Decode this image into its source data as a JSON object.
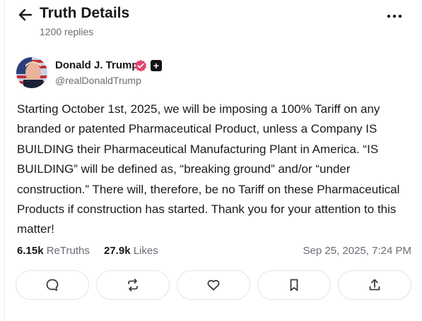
{
  "header": {
    "title": "Truth Details",
    "replies": "1200 replies"
  },
  "post": {
    "author_name": "Donald J. Trump",
    "handle": "@realDonaldTrump",
    "plus_badge": "+",
    "text": "Starting October 1st, 2025, we will be imposing a 100% Tariff on any branded or patented Pharmaceutical Product, unless a Company IS BUILDING their Pharmaceutical Manufacturing Plant in America. “IS BUILDING” will be defined as, “breaking ground” and/or “under construction.” There will, therefore, be no Tariff on these Pharmaceutical Products if construction has started. Thank you for your attention to this matter!",
    "retruths_count": "6.15k",
    "retruths_label": "ReTruths",
    "likes_count": "27.9k",
    "likes_label": "Likes",
    "timestamp": "Sep 25, 2025, 7:24 PM"
  },
  "icons": {
    "back": "arrow-left-icon",
    "more": "more-horizontal-icon",
    "verified": "verified-badge-icon",
    "reply": "comment-icon",
    "retruth": "repost-icon",
    "like": "heart-icon",
    "bookmark": "bookmark-icon",
    "share": "share-icon"
  },
  "colors": {
    "verified_badge": "#e8426e",
    "text": "#1a1a1f",
    "muted": "#6b6b75",
    "border": "#e4e4ea"
  }
}
